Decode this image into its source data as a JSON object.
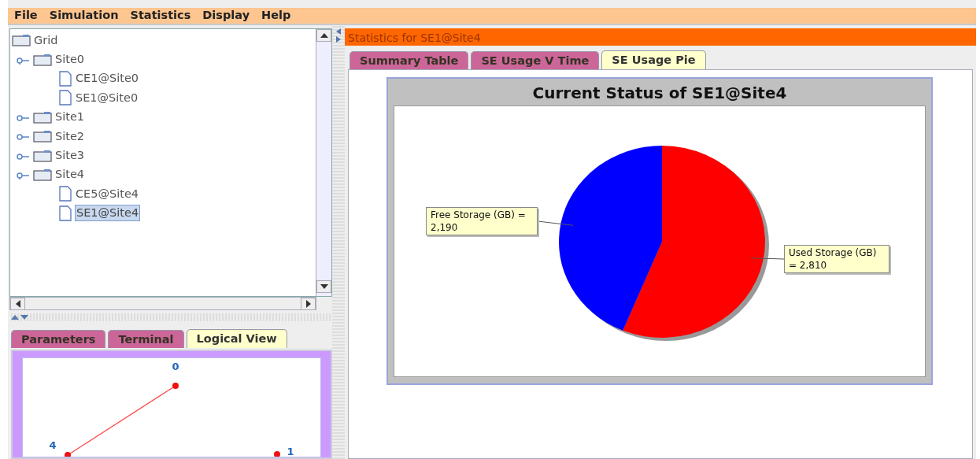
{
  "menu": [
    {
      "label": "File"
    },
    {
      "label": "Simulation"
    },
    {
      "label": "Statistics"
    },
    {
      "label": "Display"
    },
    {
      "label": "Help"
    }
  ],
  "tree": {
    "label": "Grid",
    "selected": false,
    "children": [
      {
        "label": "Site0",
        "selected": false,
        "expanded": true,
        "children": [
          {
            "label": "CE1@Site0",
            "selected": false
          },
          {
            "label": "SE1@Site0",
            "selected": false
          }
        ]
      },
      {
        "label": "Site1",
        "selected": false,
        "expanded": false
      },
      {
        "label": "Site2",
        "selected": false,
        "expanded": false
      },
      {
        "label": "Site3",
        "selected": false,
        "expanded": false
      },
      {
        "label": "Site4",
        "selected": false,
        "expanded": true,
        "children": [
          {
            "label": "CE5@Site4",
            "selected": false
          },
          {
            "label": "SE1@Site4",
            "selected": true
          }
        ]
      }
    ]
  },
  "bottom_tabs": [
    {
      "label": "Parameters",
      "selected": false
    },
    {
      "label": "Terminal",
      "selected": false
    },
    {
      "label": "Logical View",
      "selected": true
    }
  ],
  "logical_view": {
    "nodes": [
      {
        "label": "0"
      },
      {
        "label": "4"
      },
      {
        "label": "1"
      }
    ]
  },
  "stats_panel": {
    "title": "Statistics for SE1@Site4",
    "tabs": [
      {
        "label": "Summary Table",
        "selected": false
      },
      {
        "label": "SE Usage V Time",
        "selected": false
      },
      {
        "label": "SE Usage Pie",
        "selected": true
      }
    ],
    "chart_data": {
      "type": "pie",
      "title": "Current Status of SE1@Site4",
      "series": [
        {
          "values": [
            43.8,
            56.2
          ]
        }
      ],
      "value_labels": [
        "Free Storage (GB) =\n2,190",
        "Used Storage (GB)\n= 2,810"
      ]
    }
  }
}
